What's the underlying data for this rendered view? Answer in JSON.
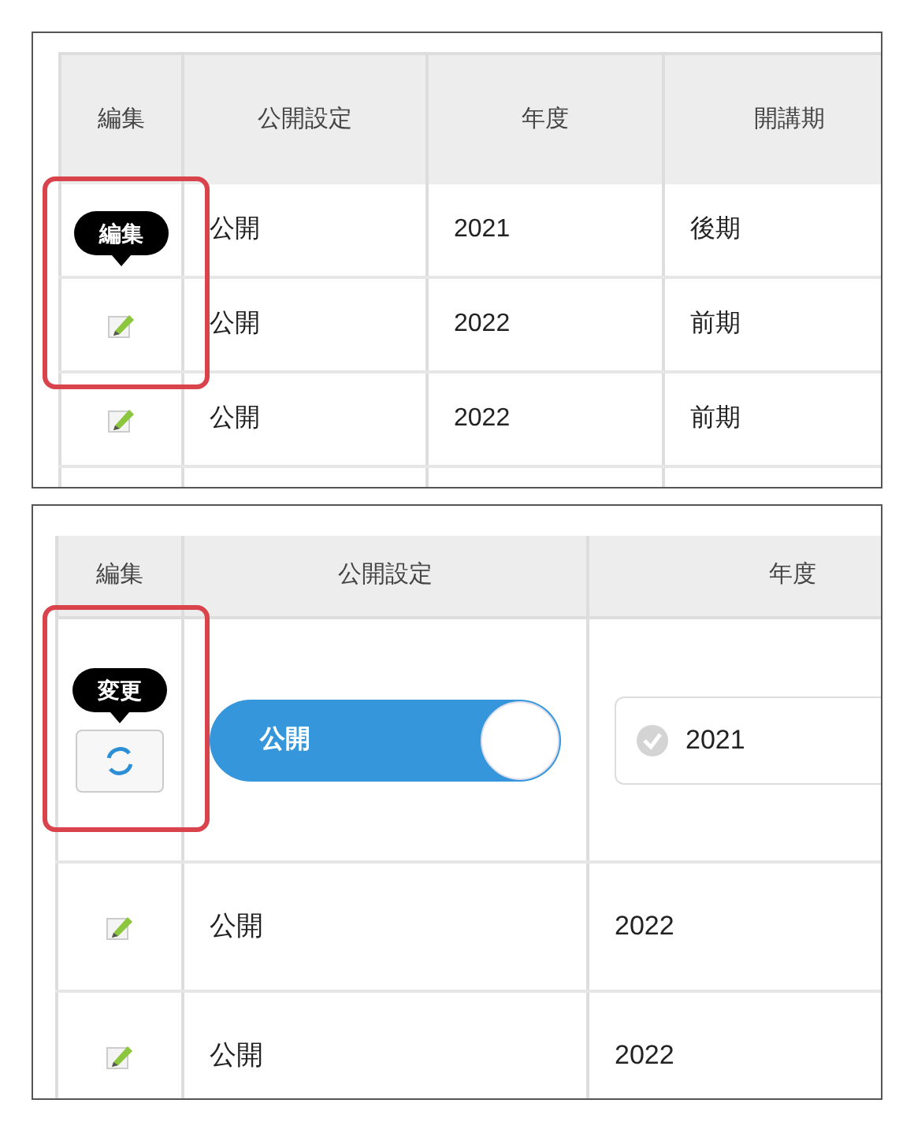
{
  "panels": [
    {
      "columns": [
        "編集",
        "公開設定",
        "年度",
        "開講期"
      ],
      "rows": [
        {
          "kind": "tooltip",
          "tooltip": "編集",
          "cells": [
            "公開",
            "2021",
            "後期"
          ]
        },
        {
          "kind": "view",
          "cells": [
            "公開",
            "2022",
            "前期"
          ]
        },
        {
          "kind": "view",
          "cells": [
            "公開",
            "2022",
            "前期"
          ]
        }
      ]
    },
    {
      "columns": [
        "編集",
        "公開設定",
        "年度"
      ],
      "rows": [
        {
          "kind": "edit",
          "tooltip": "変更",
          "toggle": {
            "label": "公開",
            "on": true
          },
          "field": {
            "value": "2021"
          }
        },
        {
          "kind": "view",
          "cells": [
            "公開",
            "2022"
          ]
        },
        {
          "kind": "view",
          "cells": [
            "公開",
            "2022"
          ]
        }
      ]
    }
  ]
}
